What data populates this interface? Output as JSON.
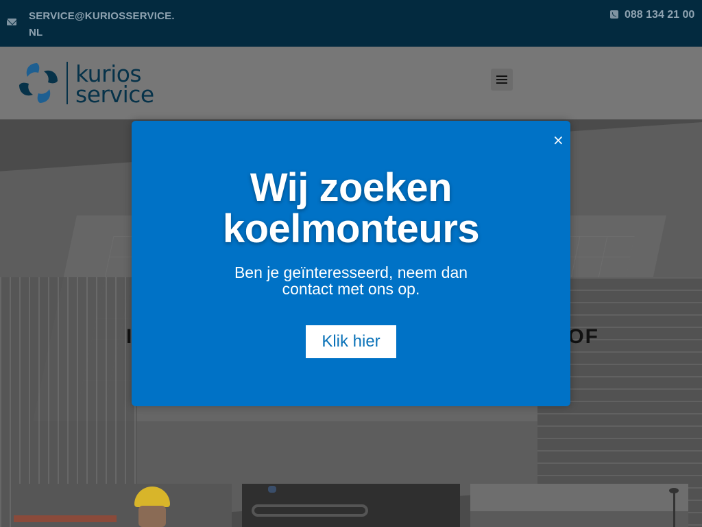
{
  "topbar": {
    "email": "SERVICE@KURIOSSERVICE.NL",
    "phone": "088 134 21 00",
    "email_icon": "envelope-icon",
    "phone_icon": "phone-icon"
  },
  "header": {
    "logo_line1": "kurios",
    "logo_line2": "service",
    "menu_icon": "hamburger-icon"
  },
  "hero": {
    "heading_left": "I",
    "heading_right": "OF"
  },
  "modal": {
    "title": "Wij zoeken koelmonteurs",
    "subtitle": "Ben je geïnteresseerd, neem dan contact met ons op.",
    "cta_label": "Klik hier",
    "close_glyph": "×",
    "background": "#0072c6"
  },
  "colors": {
    "topbar": "#032a3f",
    "brand_dark": "#063249",
    "accent": "#0072c6"
  }
}
